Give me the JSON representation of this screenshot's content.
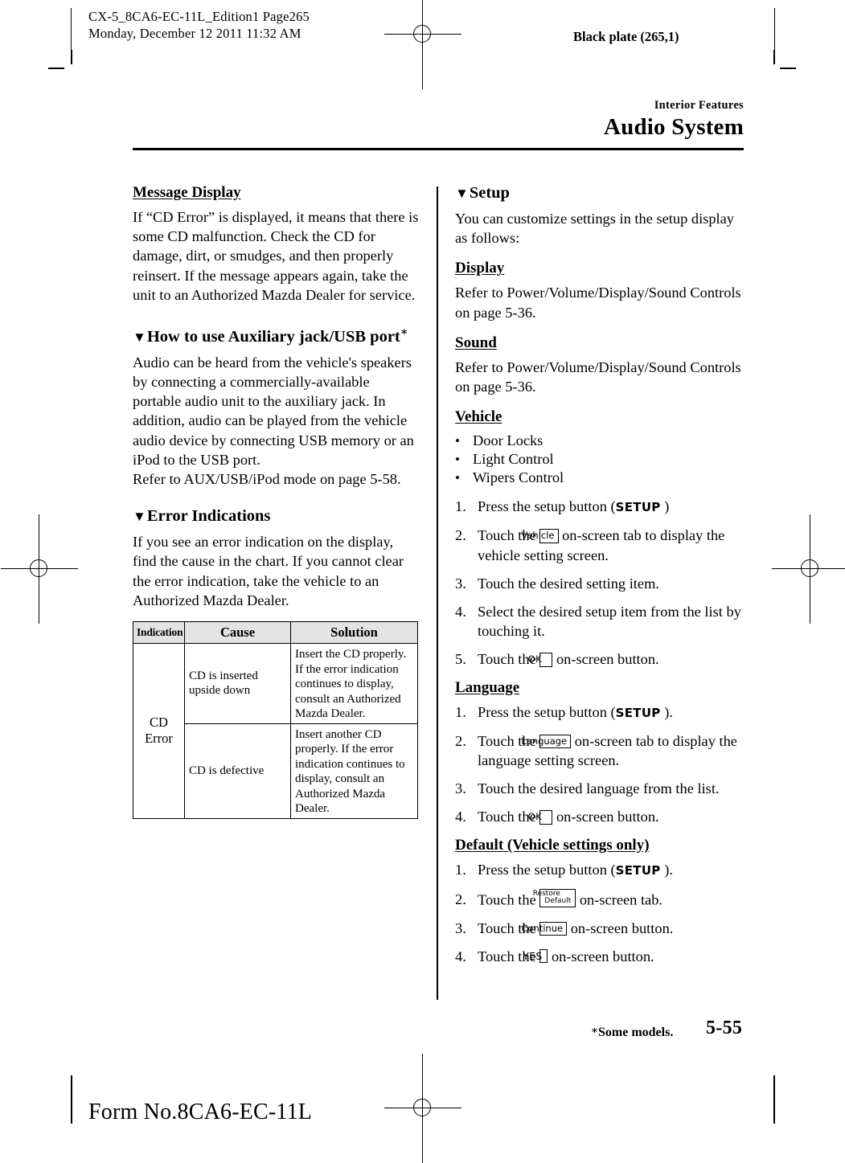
{
  "printer_marks": {
    "slug_line1": "CX-5_8CA6-EC-11L_Edition1 Page265",
    "slug_line2": "Monday, December 12 2011 11:32 AM",
    "black_plate": "Black plate (265,1)",
    "form_no": "Form No.8CA6-EC-11L"
  },
  "running_head": {
    "section": "Interior Features",
    "chapter": "Audio System"
  },
  "left_column": {
    "message_display": {
      "heading": "Message Display",
      "body": "If “CD Error” is displayed, it means that there is some CD malfunction. Check the CD for damage, dirt, or smudges, and then properly reinsert. If the message appears again, take the unit to an Authorized Mazda Dealer for service."
    },
    "aux_usb": {
      "triangle": "▼",
      "heading": "How to use Auxiliary jack/USB port",
      "heading_asterisk": "∗",
      "body1": "Audio can be heard from the vehicle's speakers by connecting a commercially-available portable audio unit to the auxiliary jack. In addition, audio can be played from the vehicle audio device by connecting USB memory or an iPod to the USB port.",
      "body2": "Refer to AUX/USB/iPod mode on page 5-58."
    },
    "error_indications": {
      "triangle": "▼",
      "heading": "Error Indications",
      "body": "If you see an error indication on the display, find the cause in the chart. If you cannot clear the error indication, take the vehicle to an Authorized Mazda Dealer."
    },
    "error_table": {
      "headers": [
        "Indication",
        "Cause",
        "Solution"
      ],
      "indication": "CD Error",
      "indication_line1": "CD",
      "indication_line2": "Error",
      "rows": [
        {
          "cause": "CD is inserted upside down",
          "solution": "Insert the CD properly. If the error indication continues to display, consult an Authorized Mazda Dealer."
        },
        {
          "cause": "CD is defective",
          "solution": "Insert another CD properly. If the error indication continues to display, consult an Authorized Mazda Dealer."
        }
      ]
    }
  },
  "right_column": {
    "setup": {
      "triangle": "▼",
      "heading": "Setup",
      "body": "You can customize settings in the setup display as follows:"
    },
    "display": {
      "heading": "Display",
      "body": "Refer to Power/Volume/Display/Sound Controls on page 5-36."
    },
    "sound": {
      "heading": "Sound",
      "body": "Refer to Power/Volume/Display/Sound Controls on page 5-36."
    },
    "vehicle": {
      "heading": "Vehicle",
      "bullet_char": "•",
      "bullets": [
        "Door Locks",
        "Light Control",
        "Wipers Control"
      ],
      "steps": [
        {
          "num": "1.",
          "pre": "Press the setup button (",
          "key": "SETUP",
          "post": " )"
        },
        {
          "num": "2.",
          "pre": "Touch the ",
          "key": "Vehicle",
          "post": " on-screen tab to display the vehicle setting screen."
        },
        {
          "num": "3.",
          "pre": "Touch the desired setting item.",
          "key": "",
          "post": ""
        },
        {
          "num": "4.",
          "pre": "Select the desired setup item from the list by touching it.",
          "key": "",
          "post": ""
        },
        {
          "num": "5.",
          "pre": "Touch the ",
          "key": "OK",
          "post": " on-screen button."
        }
      ]
    },
    "language": {
      "heading": "Language",
      "steps": [
        {
          "num": "1.",
          "pre": "Press the setup button (",
          "key": "SETUP",
          "post": " )."
        },
        {
          "num": "2.",
          "pre": "Touch the ",
          "key": "Language",
          "post": " on-screen tab to display the language setting screen."
        },
        {
          "num": "3.",
          "pre": "Touch the desired language from the list.",
          "key": "",
          "post": ""
        },
        {
          "num": "4.",
          "pre": "Touch the ",
          "key": "OK",
          "post": " on-screen button."
        }
      ]
    },
    "default": {
      "heading": "Default (Vehicle settings only)",
      "steps": [
        {
          "num": "1.",
          "pre": "Press the setup button (",
          "key": "SETUP",
          "post": " )."
        },
        {
          "num": "2.",
          "pre": "Touch the ",
          "key": "Restore Default",
          "key_line1": "Restore",
          "key_line2": "Default",
          "post": " on-screen tab."
        },
        {
          "num": "3.",
          "pre": "Touch the ",
          "key": "Continue",
          "post": " on-screen button."
        },
        {
          "num": "4.",
          "pre": "Touch the ",
          "key": "YES",
          "post": " on-screen button."
        }
      ]
    }
  },
  "footer": {
    "star": "∗",
    "footnote": "Some models.",
    "page_number": "5-55"
  }
}
